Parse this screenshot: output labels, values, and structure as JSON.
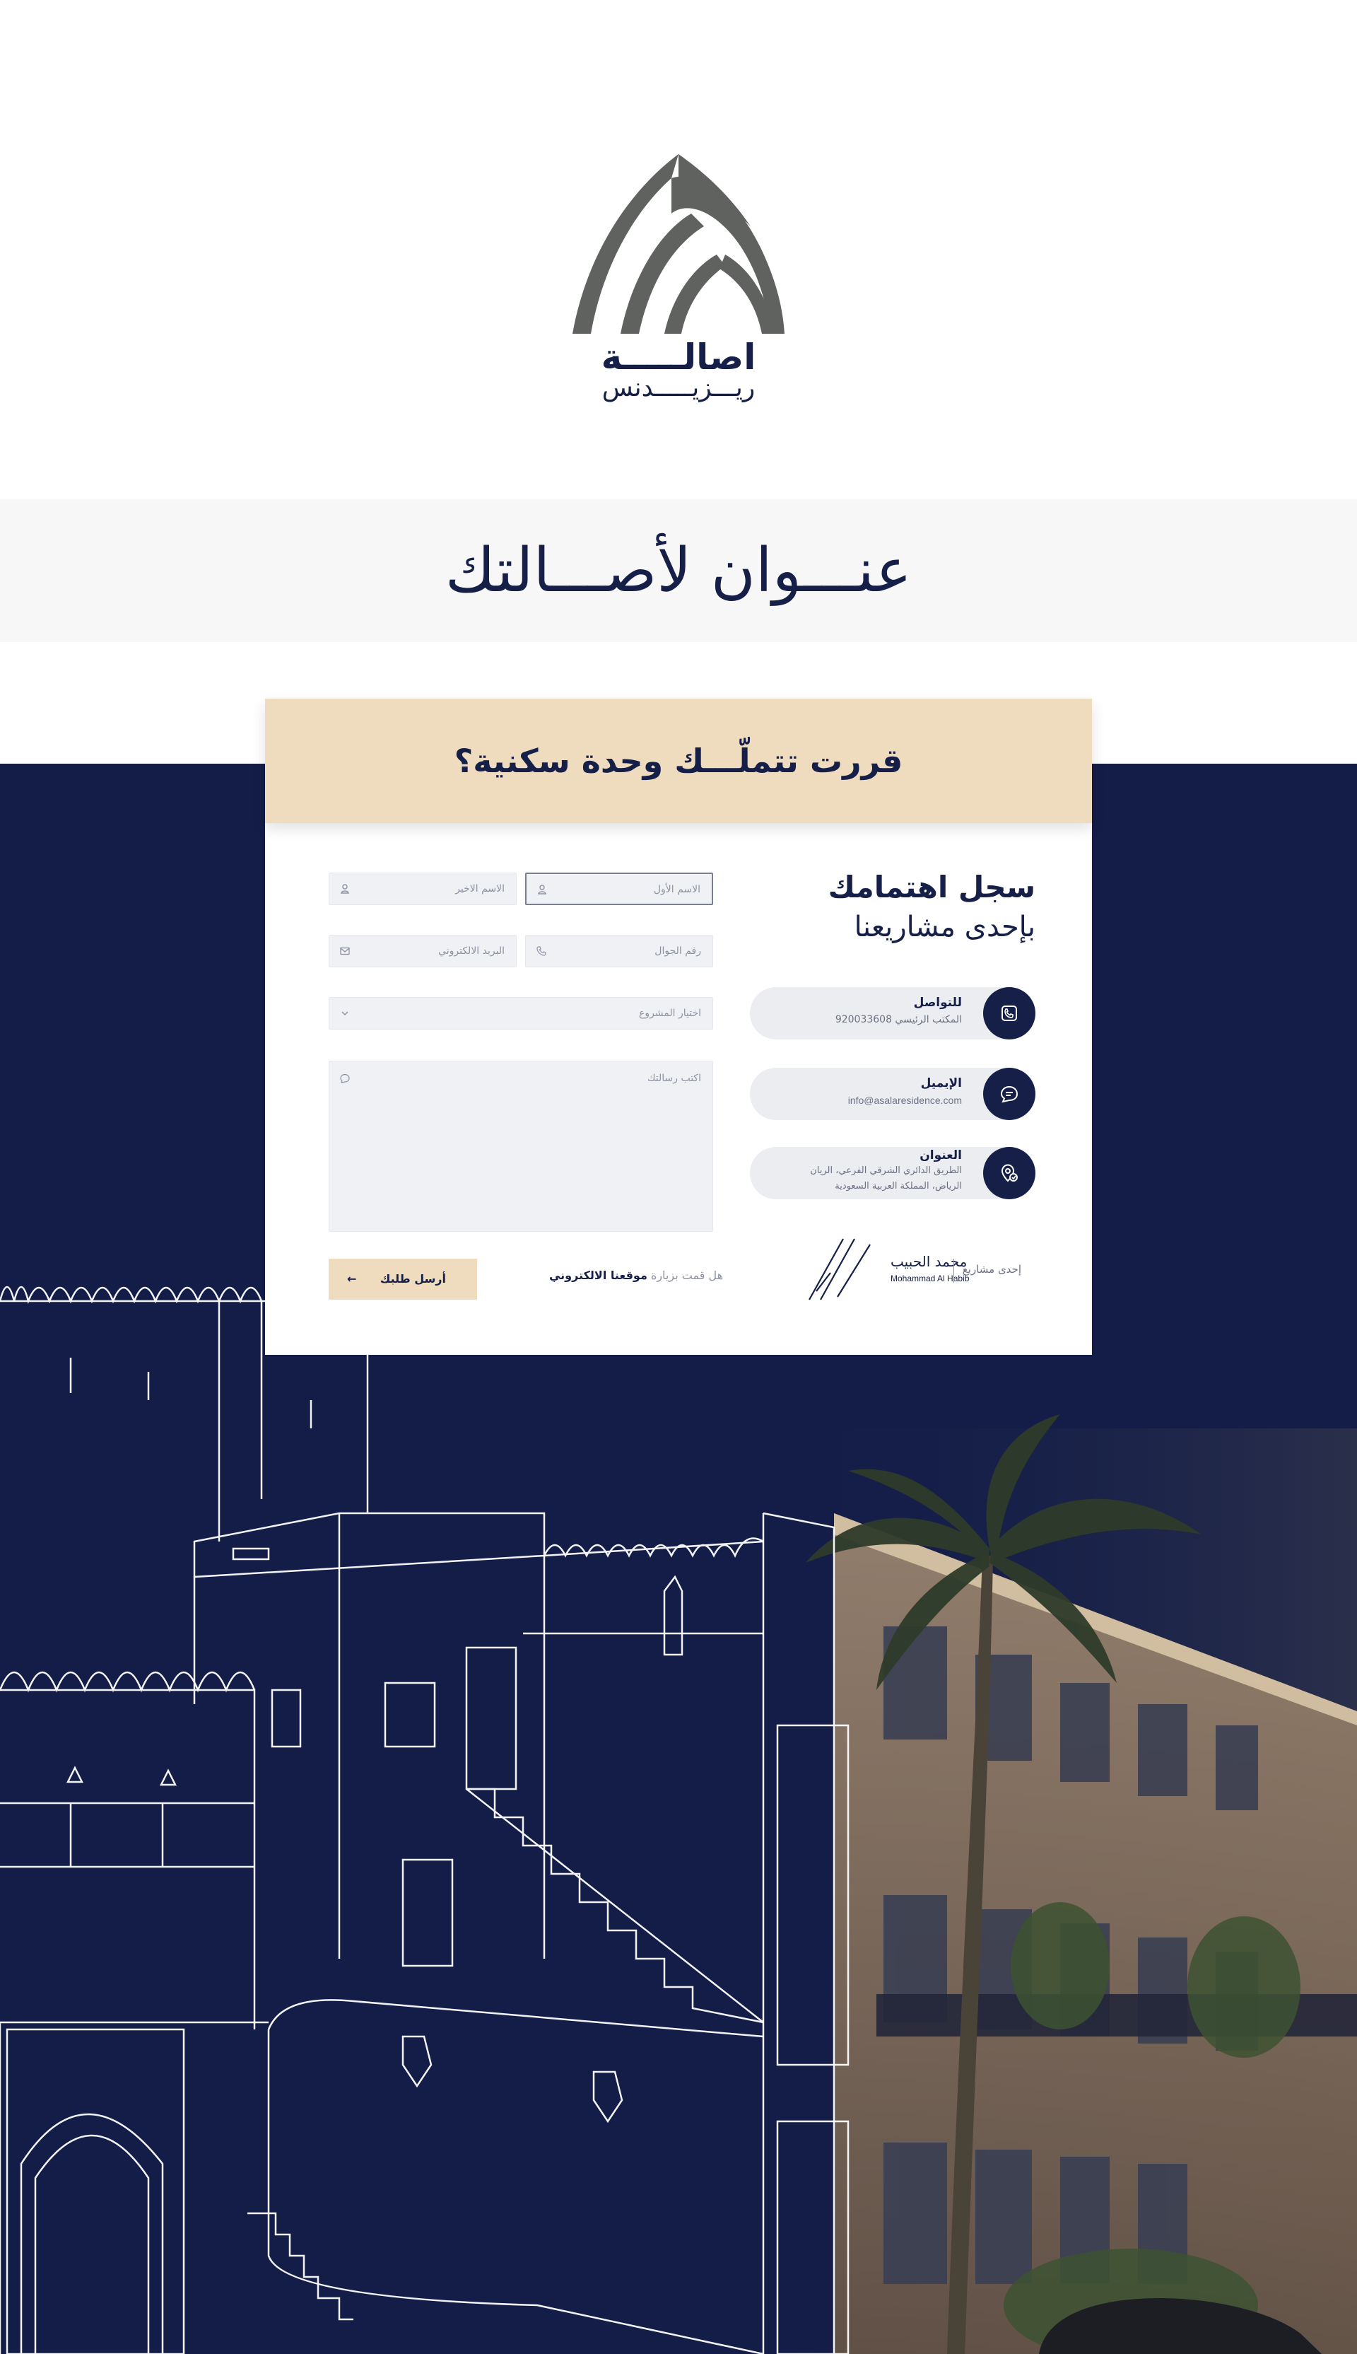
{
  "brand": {
    "name_ar": "اصالـــــة",
    "tagline_ar": "ريـــزيـــــدنس",
    "color_logo": "#5f625f",
    "color_navy": "#161f47",
    "color_beige": "#efdcbf"
  },
  "headline": "عنـــوان لأصـــالتك",
  "form_card": {
    "header_title": "قررت تتملّـــك وحدة سكنية؟",
    "fields": {
      "first_name_placeholder": "الاسم الأول",
      "last_name_placeholder": "الاسم الاخير",
      "mobile_placeholder": "رقم الجوال",
      "email_placeholder": "البريد الالكتروني",
      "project_select_placeholder": "اختيار المشروع",
      "message_placeholder": "اكتب رسالتك"
    },
    "submit_label": "أرسل طلبك",
    "visit_prefix": "هل قمت بزيارة ",
    "visit_link": "موقعنا الالكتروني"
  },
  "register": {
    "title": "سجل اهتمامك",
    "subtitle": "بإحدى مشاريعنا"
  },
  "contacts": [
    {
      "title": "للتواصل",
      "line1": "المكتب الرئيسي 920033608",
      "line2": "",
      "icon": "phone-icon"
    },
    {
      "title": "الإيميل",
      "line1": "info@asalaresidence.com",
      "line2": "",
      "icon": "chat-icon"
    },
    {
      "title": "العنوان",
      "line1": "الطريق الدائري الشرقي الفرعي، الريان",
      "line2": "الرياض، المملكة العربية السعودية",
      "icon": "location-icon"
    }
  ],
  "developer": {
    "prefix": "إحدى مشاريع",
    "name_ar": "محمد الحبيب",
    "name_en": "Mohammad Al Habib"
  }
}
